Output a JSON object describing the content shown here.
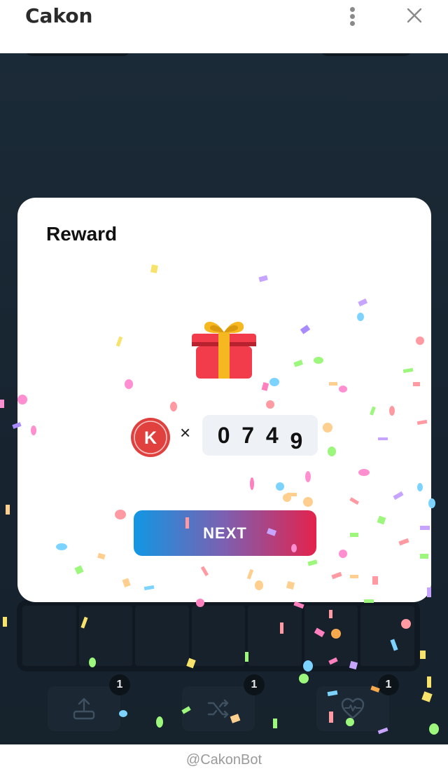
{
  "header": {
    "title": "Cakon"
  },
  "modal": {
    "title": "Reward",
    "coin_letter": "K",
    "times_symbol": "×",
    "counter_digits": [
      "0",
      "7",
      "4",
      "9"
    ],
    "next_label": "NEXT"
  },
  "tools": [
    {
      "icon": "upload-icon",
      "badge": "1"
    },
    {
      "icon": "shuffle-icon",
      "badge": "1"
    },
    {
      "icon": "heart-pulse-icon",
      "badge": "1"
    }
  ],
  "footer": {
    "text": "@CakonBot"
  },
  "colors": {
    "accent_blue": "#1197e4",
    "accent_red": "#e3234d",
    "coin_red": "#e0413f",
    "gift_red": "#f23c4b",
    "gift_ribbon": "#f5b820"
  }
}
